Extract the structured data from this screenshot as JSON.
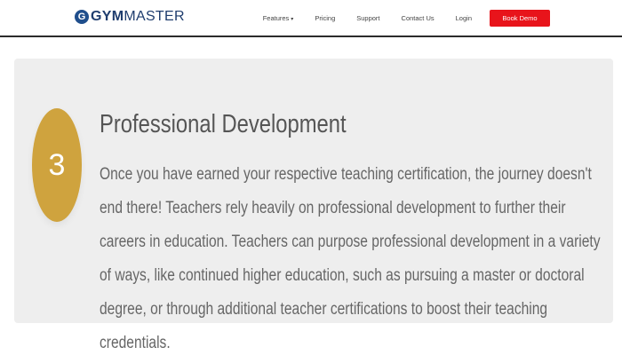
{
  "header": {
    "logo": {
      "icon": "g-logo-icon",
      "text_bold": "GYM",
      "text_light": "MASTER",
      "brand_color": "#1f3d6e"
    },
    "nav": [
      {
        "label": "Features",
        "has_dropdown": true
      },
      {
        "label": "Pricing"
      },
      {
        "label": "Support"
      },
      {
        "label": "Contact Us"
      },
      {
        "label": "Login"
      }
    ],
    "cta": {
      "label": "Book Demo",
      "color": "#e8141b"
    }
  },
  "section": {
    "step_number": "3",
    "step_color": "#cfa33e",
    "title": "Professional Development",
    "body": "Once you have earned your respective teaching certification, the journey doesn't end there! Teachers rely heavily on professional development to further their careers in education. Teachers can purpose professional development in a variety of ways, like continued higher education, such as pursuing a master or doctoral degree, or through additional teacher certifications to boost their teaching credentials."
  }
}
